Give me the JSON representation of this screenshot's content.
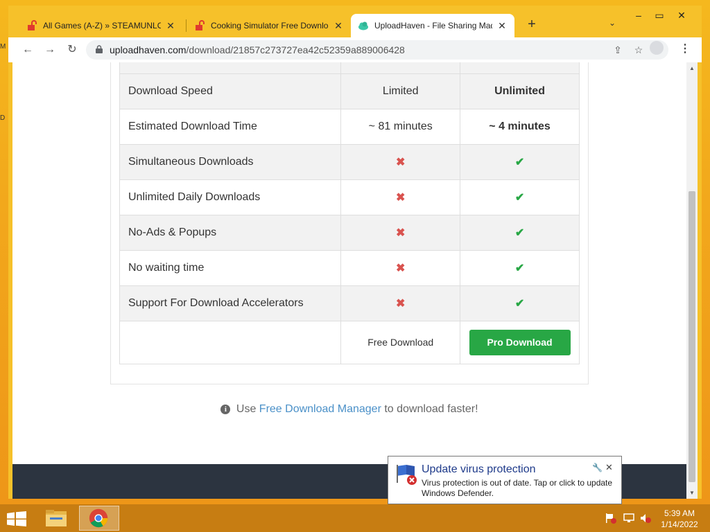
{
  "browser": {
    "tabs": [
      {
        "title": "All Games (A-Z) » STEAMUNLOCKED",
        "active": false
      },
      {
        "title": "Cooking Simulator Free Download",
        "active": false
      },
      {
        "title": "UploadHaven - File Sharing Made Simple",
        "active": true
      }
    ],
    "new_tab": "+",
    "url_host": "uploadhaven.com",
    "url_path": "/download/21857c273727ea42c52359a889006428"
  },
  "comparison": {
    "rows": [
      {
        "feature": "Download Speed",
        "free": "Limited",
        "pro": "Unlimited",
        "kind": "text"
      },
      {
        "feature": "Estimated Download Time",
        "free": "~ 81 minutes",
        "pro": "~ 4 minutes",
        "kind": "text"
      },
      {
        "feature": "Simultaneous Downloads",
        "free": "✖",
        "pro": "✔",
        "kind": "icon"
      },
      {
        "feature": "Unlimited Daily Downloads",
        "free": "✖",
        "pro": "✔",
        "kind": "icon"
      },
      {
        "feature": "No-Ads & Popups",
        "free": "✖",
        "pro": "✔",
        "kind": "icon"
      },
      {
        "feature": "No waiting time",
        "free": "✖",
        "pro": "✔",
        "kind": "icon"
      },
      {
        "feature": "Support For Download Accelerators",
        "free": "✖",
        "pro": "✔",
        "kind": "icon"
      }
    ],
    "free_download_label": "Free Download",
    "pro_download_label": "Pro Download"
  },
  "hint": {
    "prefix": "Use",
    "link": "Free Download Manager",
    "suffix": "to download faster!"
  },
  "notification": {
    "title": "Update virus protection",
    "body": "Virus protection is out of date. Tap or click to update Windows Defender."
  },
  "taskbar": {
    "time": "5:39 AM",
    "date": "1/14/2022"
  },
  "colors": {
    "accent_green": "#28a745",
    "cross_red": "#d9534f",
    "link_blue": "#4a90c8"
  }
}
